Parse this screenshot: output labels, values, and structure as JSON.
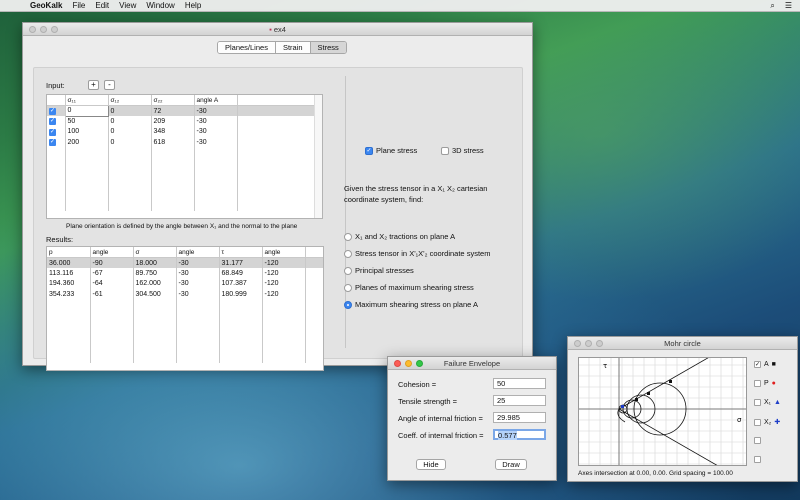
{
  "menubar": {
    "app": "GeoKalk",
    "items": [
      "File",
      "Edit",
      "View",
      "Window",
      "Help"
    ]
  },
  "main_window": {
    "title": "ex4",
    "tabs": [
      {
        "label": "Planes/Lines",
        "active": false
      },
      {
        "label": "Strain",
        "active": false
      },
      {
        "label": "Stress",
        "active": true
      }
    ],
    "input_label": "Input:",
    "add_label": "+",
    "remove_label": "-",
    "input_columns": [
      "σ₁₁",
      "σ₁₂",
      "σ₂₂",
      "angle A"
    ],
    "input_rows": [
      {
        "checked": true,
        "s11": "0",
        "s12": "0",
        "s22": "72",
        "angle": "-30"
      },
      {
        "checked": true,
        "s11": "50",
        "s12": "0",
        "s22": "209",
        "angle": "-30"
      },
      {
        "checked": true,
        "s11": "100",
        "s12": "0",
        "s22": "348",
        "angle": "-30"
      },
      {
        "checked": true,
        "s11": "200",
        "s12": "0",
        "s22": "618",
        "angle": "-30"
      }
    ],
    "plane_note": "Plane orientation is defined by the angle between X₁ and the normal to the plane",
    "results_label": "Results:",
    "result_columns": [
      "p",
      "angle",
      "σ",
      "angle",
      "τ",
      "angle"
    ],
    "result_rows": [
      [
        "36.000",
        "-90",
        "18.000",
        "-30",
        "31.177",
        "-120"
      ],
      [
        "113.116",
        "-67",
        "89.750",
        "-30",
        "68.849",
        "-120"
      ],
      [
        "194.360",
        "-64",
        "162.000",
        "-30",
        "107.387",
        "-120"
      ],
      [
        "354.233",
        "-61",
        "304.500",
        "-30",
        "180.999",
        "-120"
      ]
    ],
    "plane_stress_label": "Plane stress",
    "plane_stress_checked": true,
    "stress3d_label": "3D stress",
    "stress3d_checked": false,
    "description": "Given the stress tensor in a X₁ X₂ cartesian coordinate system, find:",
    "options": [
      {
        "label": "X₁ and X₂ tractions on plane A",
        "selected": false
      },
      {
        "label": "Stress tensor in X'₁X'₂ coordinate system",
        "selected": false
      },
      {
        "label": "Principal stresses",
        "selected": false
      },
      {
        "label": "Planes of maximum shearing stress",
        "selected": false
      },
      {
        "label": "Maximum shearing stress on plane A",
        "selected": true
      }
    ]
  },
  "failure_window": {
    "title": "Failure Envelope",
    "fields": [
      {
        "label": "Cohesion =",
        "value": "50"
      },
      {
        "label": "Tensile strength =",
        "value": "25"
      },
      {
        "label": "Angle of internal friction =",
        "value": "29.985"
      },
      {
        "label": "Coeff. of internal friction =",
        "value": "0.577"
      }
    ],
    "hide_label": "Hide",
    "draw_label": "Draw"
  },
  "mohr_window": {
    "title": "Mohr circle",
    "tau_label": "τ",
    "sigma_label": "σ",
    "legend": [
      {
        "label": "A",
        "checked": true,
        "color": "#111111",
        "marker": "■"
      },
      {
        "label": "P",
        "checked": false,
        "color": "#e02020",
        "marker": "●"
      },
      {
        "label": "X₁",
        "checked": false,
        "color": "#1e3ec8",
        "marker": "▲"
      },
      {
        "label": "X₂",
        "checked": false,
        "color": "#1e3ec8",
        "marker": "✚"
      },
      {
        "label": "",
        "checked": false,
        "color": "#cccccc",
        "marker": ""
      },
      {
        "label": "",
        "checked": false,
        "color": "#cccccc",
        "marker": ""
      }
    ],
    "footer": "Axes intersection at 0.00, 0.00. Grid spacing = 100.00"
  },
  "colors": {
    "accent": "#3b86f0",
    "close": "#fc5d56",
    "minimize": "#fdbc2e",
    "zoom": "#33c748"
  }
}
